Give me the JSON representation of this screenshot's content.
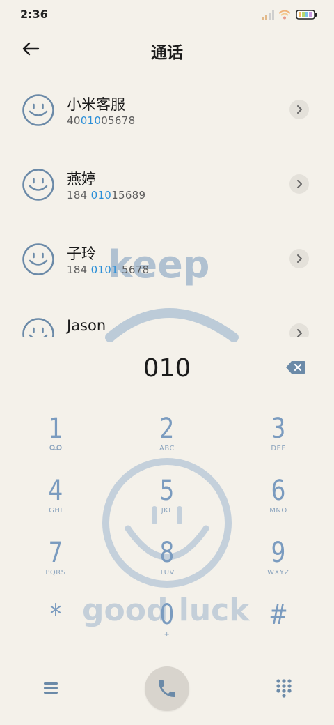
{
  "status_bar": {
    "time": "2:36"
  },
  "header": {
    "title": "通话"
  },
  "contacts": [
    {
      "name": "小米客服",
      "number_pre": "40",
      "number_hl": "010",
      "number_post": "05678"
    },
    {
      "name": "燕婷",
      "number_pre": "184 ",
      "number_hl": "010",
      "number_post": "15689"
    },
    {
      "name": "子玲",
      "number_pre": "184 ",
      "number_hl": "0101",
      "number_post": " 5678"
    },
    {
      "name": "Jason",
      "number_pre": "",
      "number_hl": "",
      "number_post": ""
    }
  ],
  "dial": {
    "number": "010"
  },
  "keypad": [
    {
      "digit": "1",
      "letters": ""
    },
    {
      "digit": "2",
      "letters": "ABC"
    },
    {
      "digit": "3",
      "letters": "DEF"
    },
    {
      "digit": "4",
      "letters": "GHI"
    },
    {
      "digit": "5",
      "letters": "JKL"
    },
    {
      "digit": "6",
      "letters": "MNO"
    },
    {
      "digit": "7",
      "letters": "PQRS"
    },
    {
      "digit": "8",
      "letters": "TUV"
    },
    {
      "digit": "9",
      "letters": "WXYZ"
    },
    {
      "digit": "*",
      "letters": ""
    },
    {
      "digit": "0",
      "letters": "+"
    },
    {
      "digit": "#",
      "letters": ""
    }
  ],
  "wallpaper": {
    "top_word": "keep",
    "bottom_word": "good luck"
  },
  "colors": {
    "accent_blue": "#2b8fd8",
    "key_blue": "#7a9bbf",
    "background": "#f4f1ea"
  }
}
